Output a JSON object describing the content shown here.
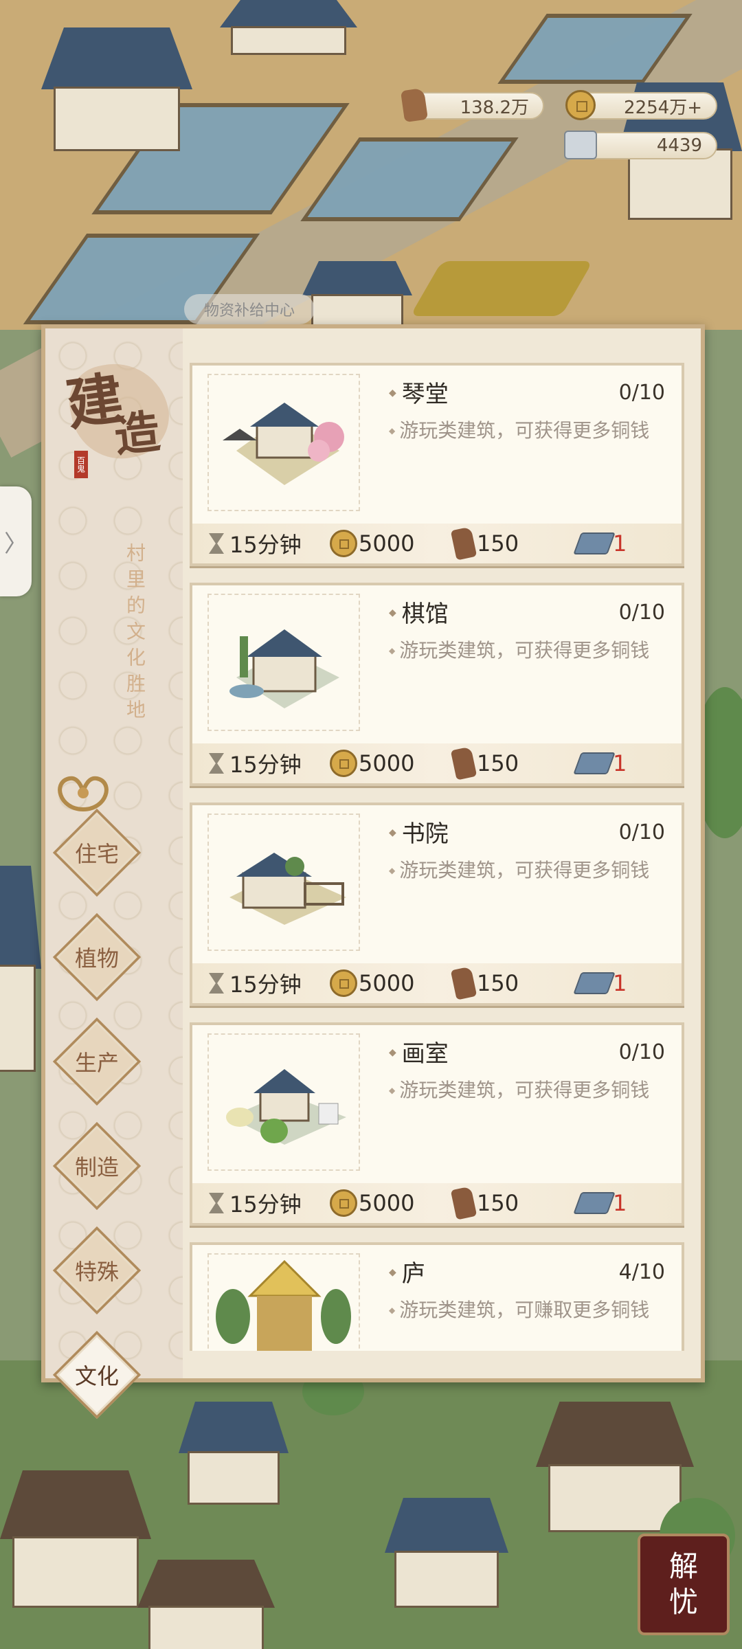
{
  "resources": {
    "wood": "138.2万",
    "coins": "2254万+",
    "stone": "4439"
  },
  "peek_label": "物资补给中心",
  "side_tab_arrow": "〉",
  "panel": {
    "title_char1": "建",
    "title_char2": "造",
    "seal_text": "百鬼",
    "subtitle": "村里的文化胜地"
  },
  "categories": [
    {
      "label": "住宅"
    },
    {
      "label": "植物"
    },
    {
      "label": "生产"
    },
    {
      "label": "制造"
    },
    {
      "label": "特殊"
    },
    {
      "label": "文化"
    }
  ],
  "active_category": "文化",
  "buildings": [
    {
      "name": "琴堂",
      "count": "0/10",
      "desc": "游玩类建筑，可获得更多铜钱",
      "time": "15分钟",
      "coins": "5000",
      "wood": "150",
      "tiles": "1",
      "thumb_icon": "qintang-building-icon"
    },
    {
      "name": "棋馆",
      "count": "0/10",
      "desc": "游玩类建筑，可获得更多铜钱",
      "time": "15分钟",
      "coins": "5000",
      "wood": "150",
      "tiles": "1",
      "thumb_icon": "qiguan-building-icon"
    },
    {
      "name": "书院",
      "count": "0/10",
      "desc": "游玩类建筑，可获得更多铜钱",
      "time": "15分钟",
      "coins": "5000",
      "wood": "150",
      "tiles": "1",
      "thumb_icon": "shuyuan-building-icon"
    },
    {
      "name": "画室",
      "count": "0/10",
      "desc": "游玩类建筑，可获得更多铜钱",
      "time": "15分钟",
      "coins": "5000",
      "wood": "150",
      "tiles": "1",
      "thumb_icon": "huashi-building-icon"
    },
    {
      "name": "庐",
      "count": "4/10",
      "desc": "游玩类建筑，可赚取更多铜钱",
      "time": "",
      "coins": "",
      "wood": "",
      "tiles": "",
      "thumb_icon": "lu-hut-icon"
    }
  ],
  "badge": {
    "line1": "解",
    "line2": "忧"
  },
  "colors": {
    "accent_red": "#c8352a",
    "panel_border": "#c8ad85",
    "roof_blue": "#3f5670"
  }
}
